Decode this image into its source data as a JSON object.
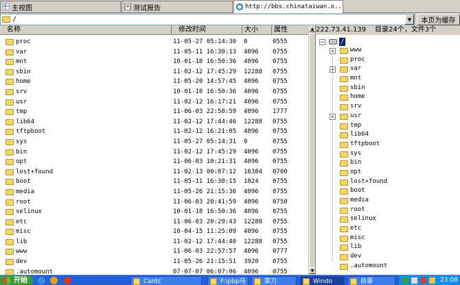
{
  "tabs": [
    {
      "label": "主视图",
      "icon": "grid-icon"
    },
    {
      "label": "测试报告",
      "icon": "document-icon"
    },
    {
      "label": "http://bbs.chinataiwan.o...",
      "icon": "ie-icon"
    }
  ],
  "path": {
    "value": "/",
    "cache_button": "本页为缓存"
  },
  "file_list": {
    "columns": {
      "name": "名称",
      "modified": "修改时间",
      "size": "大小",
      "attr": "属性"
    },
    "rows": [
      {
        "name": "proc",
        "modified": "11-05-27 05:14:30",
        "size": "0",
        "attr": "0555"
      },
      {
        "name": "var",
        "modified": "11-05-11 16:30:13",
        "size": "4096",
        "attr": "0755"
      },
      {
        "name": "mnt",
        "modified": "10-01-18 16:50:36",
        "size": "4096",
        "attr": "0755"
      },
      {
        "name": "sbin",
        "modified": "11-02-12 17:45:29",
        "size": "12288",
        "attr": "0755"
      },
      {
        "name": "home",
        "modified": "11-05-20 14:57:45",
        "size": "4096",
        "attr": "0755"
      },
      {
        "name": "srv",
        "modified": "10-01-18 16:50:36",
        "size": "4096",
        "attr": "0755"
      },
      {
        "name": "usr",
        "modified": "11-02-12 16:17:21",
        "size": "4096",
        "attr": "0755"
      },
      {
        "name": "tmp",
        "modified": "11-06-03 22:58:59",
        "size": "4096",
        "attr": "1777"
      },
      {
        "name": "lib64",
        "modified": "11-02-12 17:44:46",
        "size": "12288",
        "attr": "0755"
      },
      {
        "name": "tftpboot",
        "modified": "11-02-12 16:21:05",
        "size": "4096",
        "attr": "0755"
      },
      {
        "name": "sys",
        "modified": "11-05-27 05:14:31",
        "size": "0",
        "attr": "0755"
      },
      {
        "name": "bin",
        "modified": "11-02-12 17:45:29",
        "size": "4096",
        "attr": "0755"
      },
      {
        "name": "opt",
        "modified": "11-06-03 10:21:31",
        "size": "4096",
        "attr": "0755"
      },
      {
        "name": "lost+found",
        "modified": "11-02-13 00:07:12",
        "size": "16384",
        "attr": "0700"
      },
      {
        "name": "boot",
        "modified": "11-05-11 16:30:15",
        "size": "1024",
        "attr": "0755"
      },
      {
        "name": "media",
        "modified": "11-05-26 21:15:36",
        "size": "4096",
        "attr": "0755"
      },
      {
        "name": "root",
        "modified": "11-06-03 20:41:59",
        "size": "4096",
        "attr": "0750"
      },
      {
        "name": "selinux",
        "modified": "10-01-18 16:50:36",
        "size": "4096",
        "attr": "0755"
      },
      {
        "name": "etc",
        "modified": "11-06-03 20:29:43",
        "size": "12288",
        "attr": "0755"
      },
      {
        "name": "misc",
        "modified": "10-04-15 11:25:09",
        "size": "4096",
        "attr": "0755"
      },
      {
        "name": "lib",
        "modified": "11-02-12 17:44:40",
        "size": "12288",
        "attr": "0755"
      },
      {
        "name": "www",
        "modified": "11-06-03 22:57:57",
        "size": "4096",
        "attr": "0777"
      },
      {
        "name": "dev",
        "modified": "11-05-26 21:15:51",
        "size": "3920",
        "attr": "0755"
      },
      {
        "name": ".automount",
        "modified": "07-07-07 06:07:06",
        "size": "4096",
        "attr": "0755"
      }
    ]
  },
  "tree_panel": {
    "ip": "222.73.41.139",
    "summary": "目录24个，文件3个",
    "root_label": "/",
    "nodes": [
      {
        "name": "www",
        "expandable": true
      },
      {
        "name": "proc",
        "expandable": false
      },
      {
        "name": "var",
        "expandable": true
      },
      {
        "name": "mnt",
        "expandable": false
      },
      {
        "name": "sbin",
        "expandable": false
      },
      {
        "name": "home",
        "expandable": false
      },
      {
        "name": "srv",
        "expandable": false
      },
      {
        "name": "usr",
        "expandable": true
      },
      {
        "name": "tmp",
        "expandable": false
      },
      {
        "name": "lib64",
        "expandable": false
      },
      {
        "name": "tftpboot",
        "expandable": false
      },
      {
        "name": "sys",
        "expandable": false
      },
      {
        "name": "bin",
        "expandable": false
      },
      {
        "name": "opt",
        "expandable": false
      },
      {
        "name": "lost+found",
        "expandable": false
      },
      {
        "name": "boot",
        "expandable": false
      },
      {
        "name": "media",
        "expandable": false
      },
      {
        "name": "root",
        "expandable": false
      },
      {
        "name": "selinux",
        "expandable": false
      },
      {
        "name": "etc",
        "expandable": false
      },
      {
        "name": "misc",
        "expandable": false
      },
      {
        "name": "lib",
        "expandable": false
      },
      {
        "name": "dev",
        "expandable": false
      },
      {
        "name": ".automount",
        "expandable": false
      }
    ]
  },
  "taskbar": {
    "start_label": "开始",
    "tasks": [
      {
        "label": "Cantc",
        "active": false
      },
      {
        "label": "F:\\pbp马",
        "active": false
      },
      {
        "label": "菜刀",
        "active": false
      },
      {
        "label": "Windo",
        "active": true
      },
      {
        "label": "目录",
        "active": false
      }
    ],
    "clock": "23:08"
  },
  "colors": {
    "selection": "#0a246a",
    "taskbar": "#245edb",
    "start": "#3c9a3c",
    "folder": "#f5d66b"
  }
}
